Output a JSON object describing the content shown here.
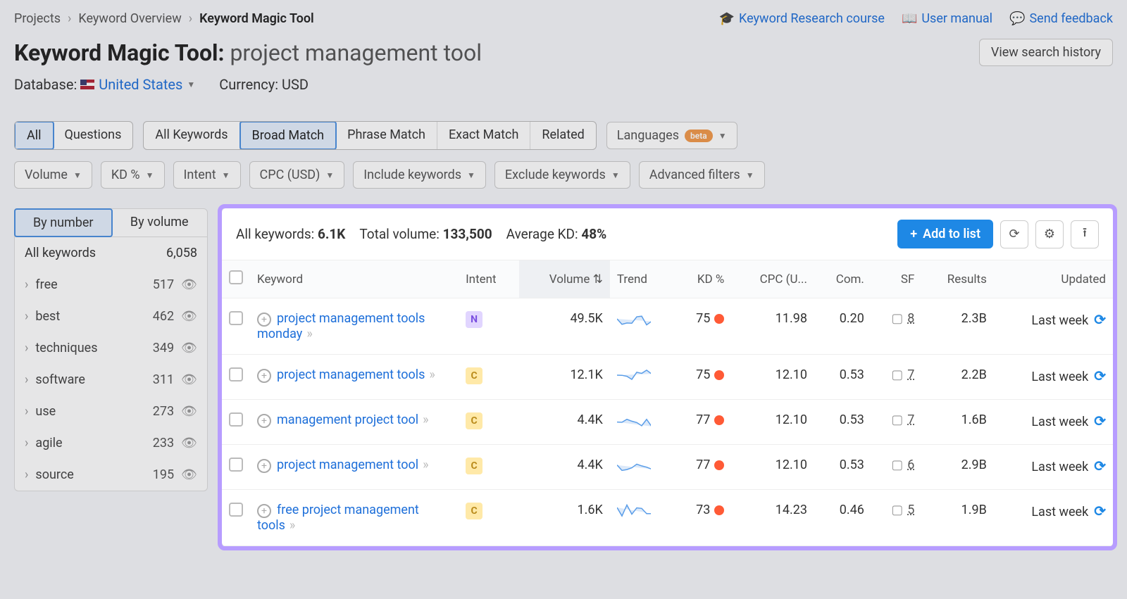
{
  "breadcrumb": [
    "Projects",
    "Keyword Overview",
    "Keyword Magic Tool"
  ],
  "page_title_prefix": "Keyword Magic Tool:",
  "page_title_query": "project management tool",
  "top_links": {
    "research": "Keyword Research course",
    "manual": "User manual",
    "feedback": "Send feedback"
  },
  "view_history_btn": "View search history",
  "meta": {
    "database_label": "Database:",
    "database_value": "United States",
    "currency_label": "Currency:",
    "currency_value": "USD"
  },
  "tab_group1": [
    "All",
    "Questions"
  ],
  "tab_group1_active": 0,
  "tab_group2": [
    "All Keywords",
    "Broad Match",
    "Phrase Match",
    "Exact Match",
    "Related"
  ],
  "tab_group2_active": 1,
  "languages_label": "Languages",
  "beta_label": "beta",
  "filters": [
    "Volume",
    "KD %",
    "Intent",
    "CPC (USD)",
    "Include keywords",
    "Exclude keywords",
    "Advanced filters"
  ],
  "sidebar": {
    "seg": [
      "By number",
      "By volume"
    ],
    "seg_active": 0,
    "head_label": "All keywords",
    "head_count": "6,058",
    "items": [
      {
        "label": "free",
        "count": "517"
      },
      {
        "label": "best",
        "count": "462"
      },
      {
        "label": "techniques",
        "count": "349"
      },
      {
        "label": "software",
        "count": "311"
      },
      {
        "label": "use",
        "count": "273"
      },
      {
        "label": "agile",
        "count": "233"
      },
      {
        "label": "source",
        "count": "195"
      }
    ]
  },
  "summary": {
    "all_label": "All keywords:",
    "all_value": "6.1K",
    "volume_label": "Total volume:",
    "volume_value": "133,500",
    "kd_label": "Average KD:",
    "kd_value": "48%",
    "add_btn": "Add to list"
  },
  "columns": [
    "",
    "Keyword",
    "Intent",
    "Volume",
    "Trend",
    "KD %",
    "CPC (U...",
    "Com.",
    "SF",
    "Results",
    "Updated"
  ],
  "rows": [
    {
      "keyword": "project management tools monday",
      "intent": "N",
      "volume": "49.5K",
      "kd": "75",
      "cpc": "11.98",
      "com": "0.20",
      "sf": "8",
      "results": "2.3B",
      "updated": "Last week"
    },
    {
      "keyword": "project management tools",
      "intent": "C",
      "volume": "12.1K",
      "kd": "75",
      "cpc": "12.10",
      "com": "0.53",
      "sf": "7",
      "results": "2.2B",
      "updated": "Last week"
    },
    {
      "keyword": "management project tool",
      "intent": "C",
      "volume": "4.4K",
      "kd": "77",
      "cpc": "12.10",
      "com": "0.53",
      "sf": "7",
      "results": "1.6B",
      "updated": "Last week"
    },
    {
      "keyword": "project management tool",
      "intent": "C",
      "volume": "4.4K",
      "kd": "77",
      "cpc": "12.10",
      "com": "0.53",
      "sf": "6",
      "results": "2.9B",
      "updated": "Last week"
    },
    {
      "keyword": "free project management tools",
      "intent": "C",
      "volume": "1.6K",
      "kd": "73",
      "cpc": "14.23",
      "com": "0.46",
      "sf": "5",
      "results": "1.9B",
      "updated": "Last week"
    }
  ]
}
